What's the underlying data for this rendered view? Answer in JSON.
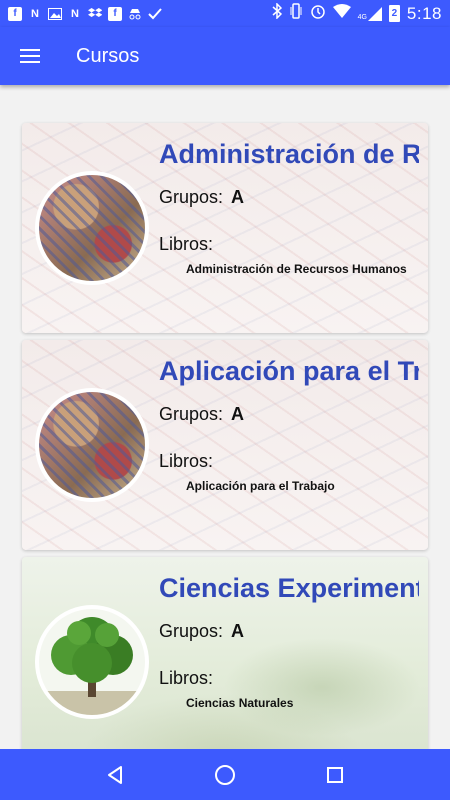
{
  "status_bar": {
    "notification_icons": [
      "facebook-icon",
      "n-icon",
      "image-icon",
      "n-icon",
      "dropbox-icon",
      "facebook-icon",
      "incognito-icon",
      "check-icon"
    ],
    "network": "4G",
    "battery": "2",
    "time": "5:18"
  },
  "app_bar": {
    "title": "Cursos",
    "menu_icon": "hamburger-menu-icon"
  },
  "courses": [
    {
      "title": "Administración de Recursos Humanos",
      "grupos_label": "Grupos:",
      "grupos_value": "A",
      "libros_label": "Libros:",
      "book": "Administración de Recursos Humanos",
      "image": "puzzle"
    },
    {
      "title": "Aplicación para el Trabajo",
      "grupos_label": "Grupos:",
      "grupos_value": "A",
      "libros_label": "Libros:",
      "book": "Aplicación para el Trabajo",
      "image": "puzzle"
    },
    {
      "title": "Ciencias Experimentales",
      "grupos_label": "Grupos:",
      "grupos_value": "A",
      "libros_label": "Libros:",
      "book": "Ciencias Naturales",
      "image": "tree"
    }
  ],
  "nav_bar": {
    "buttons": [
      "back-icon",
      "home-icon",
      "recents-icon"
    ]
  },
  "colors": {
    "primary": "#3d5afe",
    "title_blue": "#3149b8"
  }
}
